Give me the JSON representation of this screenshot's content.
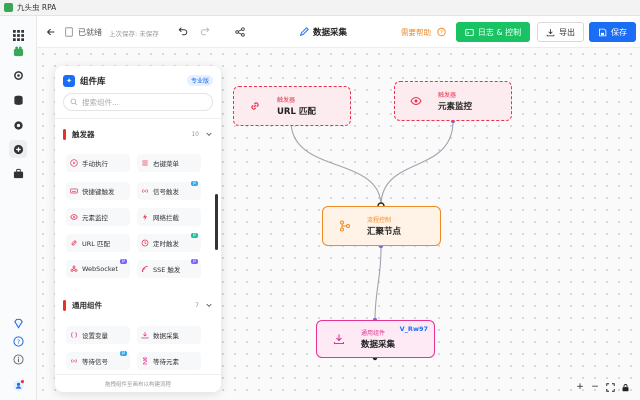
{
  "window": {
    "title": "九头虫 RPA"
  },
  "toolbar": {
    "status": "已就绪",
    "last_saved": "上次保存: 未保存",
    "flow_name": "数据采集",
    "help": "需要帮助",
    "logs_button": "日志 & 控制",
    "export_button": "导出",
    "save_button": "保存"
  },
  "panel": {
    "title": "组件库",
    "badge": "专业版",
    "search_placeholder": "搜索组件...",
    "footer": "拖拽组件至画布以构建流程",
    "sections": [
      {
        "title": "触发器",
        "count": "10",
        "items": [
          {
            "label": "手动执行",
            "icon": "play-icon",
            "tag": ""
          },
          {
            "label": "右键菜单",
            "icon": "menu-icon",
            "tag": ""
          },
          {
            "label": "快捷键触发",
            "icon": "keyboard-icon",
            "tag": ""
          },
          {
            "label": "信号触发",
            "icon": "signal-icon",
            "tag": "β"
          },
          {
            "label": "元素监控",
            "icon": "eye-icon",
            "tag": ""
          },
          {
            "label": "网络拦截",
            "icon": "bolt-icon",
            "tag": ""
          },
          {
            "label": "URL 匹配",
            "icon": "link-icon",
            "tag": ""
          },
          {
            "label": "定时触发",
            "icon": "clock-icon",
            "tag": "β"
          },
          {
            "label": "WebSocket",
            "icon": "websocket-icon",
            "tag": "β"
          },
          {
            "label": "SSE 触发",
            "icon": "sse-icon",
            "tag": "β"
          }
        ]
      },
      {
        "title": "通用组件",
        "count": "7",
        "items": [
          {
            "label": "设置变量",
            "icon": "variable-icon",
            "tag": ""
          },
          {
            "label": "数据采集",
            "icon": "download-icon",
            "tag": ""
          },
          {
            "label": "等待信号",
            "icon": "signal-icon",
            "tag": "β"
          },
          {
            "label": "等待元素",
            "icon": "hourglass-icon",
            "tag": ""
          }
        ]
      }
    ]
  },
  "nodes": {
    "url_match": {
      "tag": "触发器",
      "title": "URL 匹配"
    },
    "element_watch": {
      "tag": "触发器",
      "title": "元素监控"
    },
    "merge": {
      "tag": "流程控制",
      "title": "汇聚节点"
    },
    "data_collect": {
      "tag": "通用组件",
      "title": "数据采集",
      "id": "V_Rw97"
    }
  },
  "colors": {
    "trigger": "#e6334f",
    "control": "#f08a24",
    "general": "#e6338f",
    "primary": "#1b6ef3",
    "success": "#19c263"
  }
}
